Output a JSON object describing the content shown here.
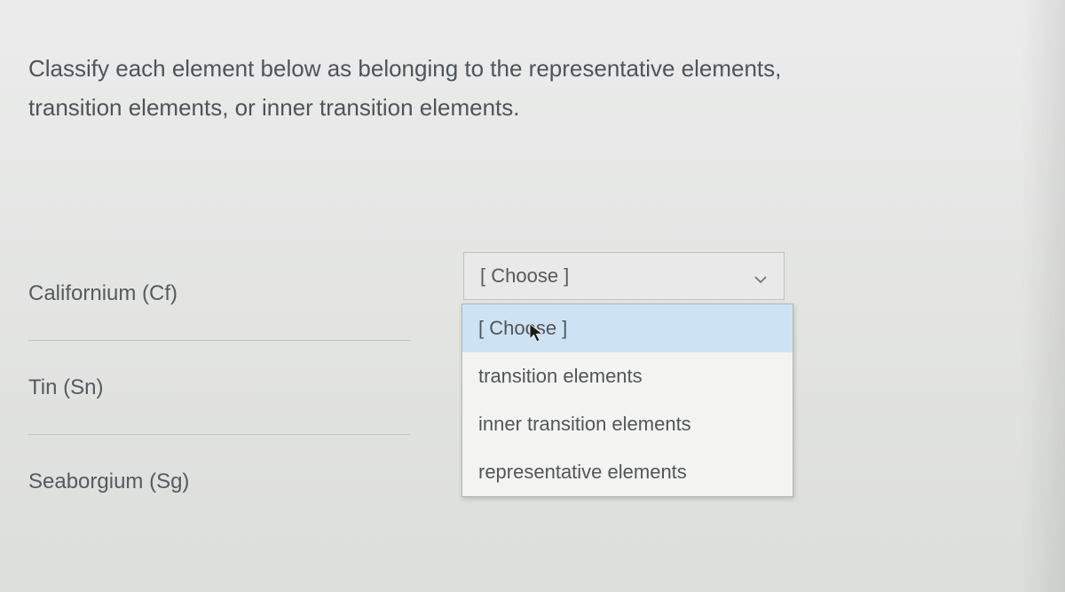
{
  "prompt": "Classify each element below as belonging to the representative elements, transition elements, or inner transition elements.",
  "rows": [
    {
      "label": "Californium (Cf)"
    },
    {
      "label": "Tin (Sn)"
    },
    {
      "label": "Seaborgium (Sg)"
    }
  ],
  "select": {
    "placeholder": "[ Choose ]",
    "options": [
      "[ Choose ]",
      "transition elements",
      "inner transition elements",
      "representative elements"
    ]
  }
}
